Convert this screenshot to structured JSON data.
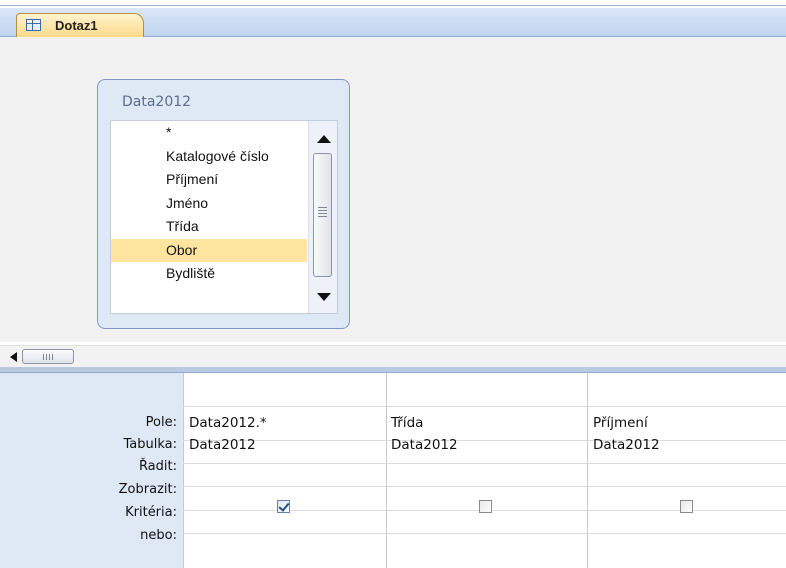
{
  "window": {
    "tab_label": "Dotaz1"
  },
  "table_box": {
    "title": "Data2012",
    "fields": [
      "*",
      "Katalogové číslo",
      "Příjmení",
      "Jméno",
      "Třída",
      "Obor",
      "Bydliště"
    ],
    "selected_field": "Obor"
  },
  "grid": {
    "row_labels": {
      "field": "Pole:",
      "table": "Tabulka:",
      "sort": "Řadit:",
      "show": "Zobrazit:",
      "criteria": "Kritéria:",
      "or": "nebo:"
    },
    "columns": [
      {
        "field": "Data2012.*",
        "table": "Data2012",
        "sort": "",
        "show": true,
        "criteria": "",
        "or": ""
      },
      {
        "field": "Třída",
        "table": "Data2012",
        "sort": "",
        "show": false,
        "criteria": "",
        "or": ""
      },
      {
        "field": "Příjmení",
        "table": "Data2012",
        "sort": "",
        "show": false,
        "criteria": "",
        "or": ""
      }
    ]
  }
}
